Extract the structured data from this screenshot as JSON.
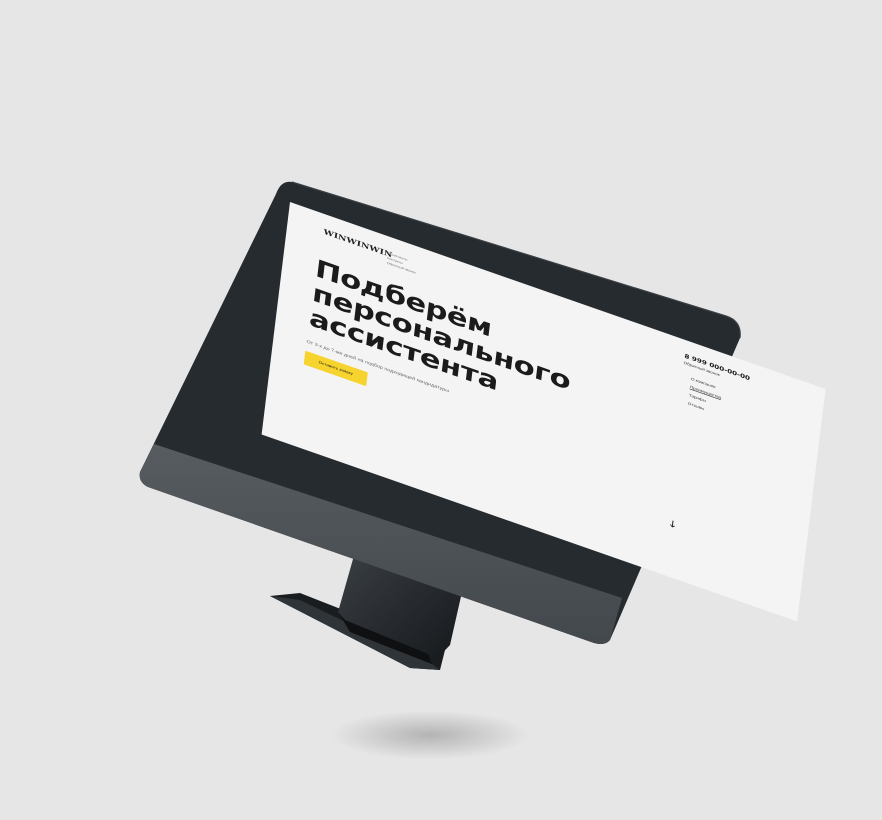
{
  "site": {
    "logo": "WINWINWIN",
    "top_nav": [
      "Ассистенты",
      "Контакты",
      "Обратный звонок"
    ],
    "phone": "8 999 000-00-00",
    "callback_link": "Обратный звонок",
    "side_nav": [
      {
        "label": "О компании",
        "active": false
      },
      {
        "label": "Преимущества",
        "active": true
      },
      {
        "label": "Тарифы",
        "active": false
      },
      {
        "label": "Отзывы",
        "active": false
      }
    ],
    "headline_lines": [
      "Подберём",
      "персонального",
      "ассистента"
    ],
    "subtitle": "От 3-х до 7-ми дней на подбор подходящей кандидатуры",
    "cta_label": "Оставить заявку",
    "scroll_icon": "arrow-down-icon"
  },
  "colors": {
    "background": "#e6e6e6",
    "screen": "#f4f4f4",
    "bezel": "#262b2f",
    "chin": "#4d5257",
    "accent": "#f6d32d",
    "text": "#1b1b1b"
  }
}
